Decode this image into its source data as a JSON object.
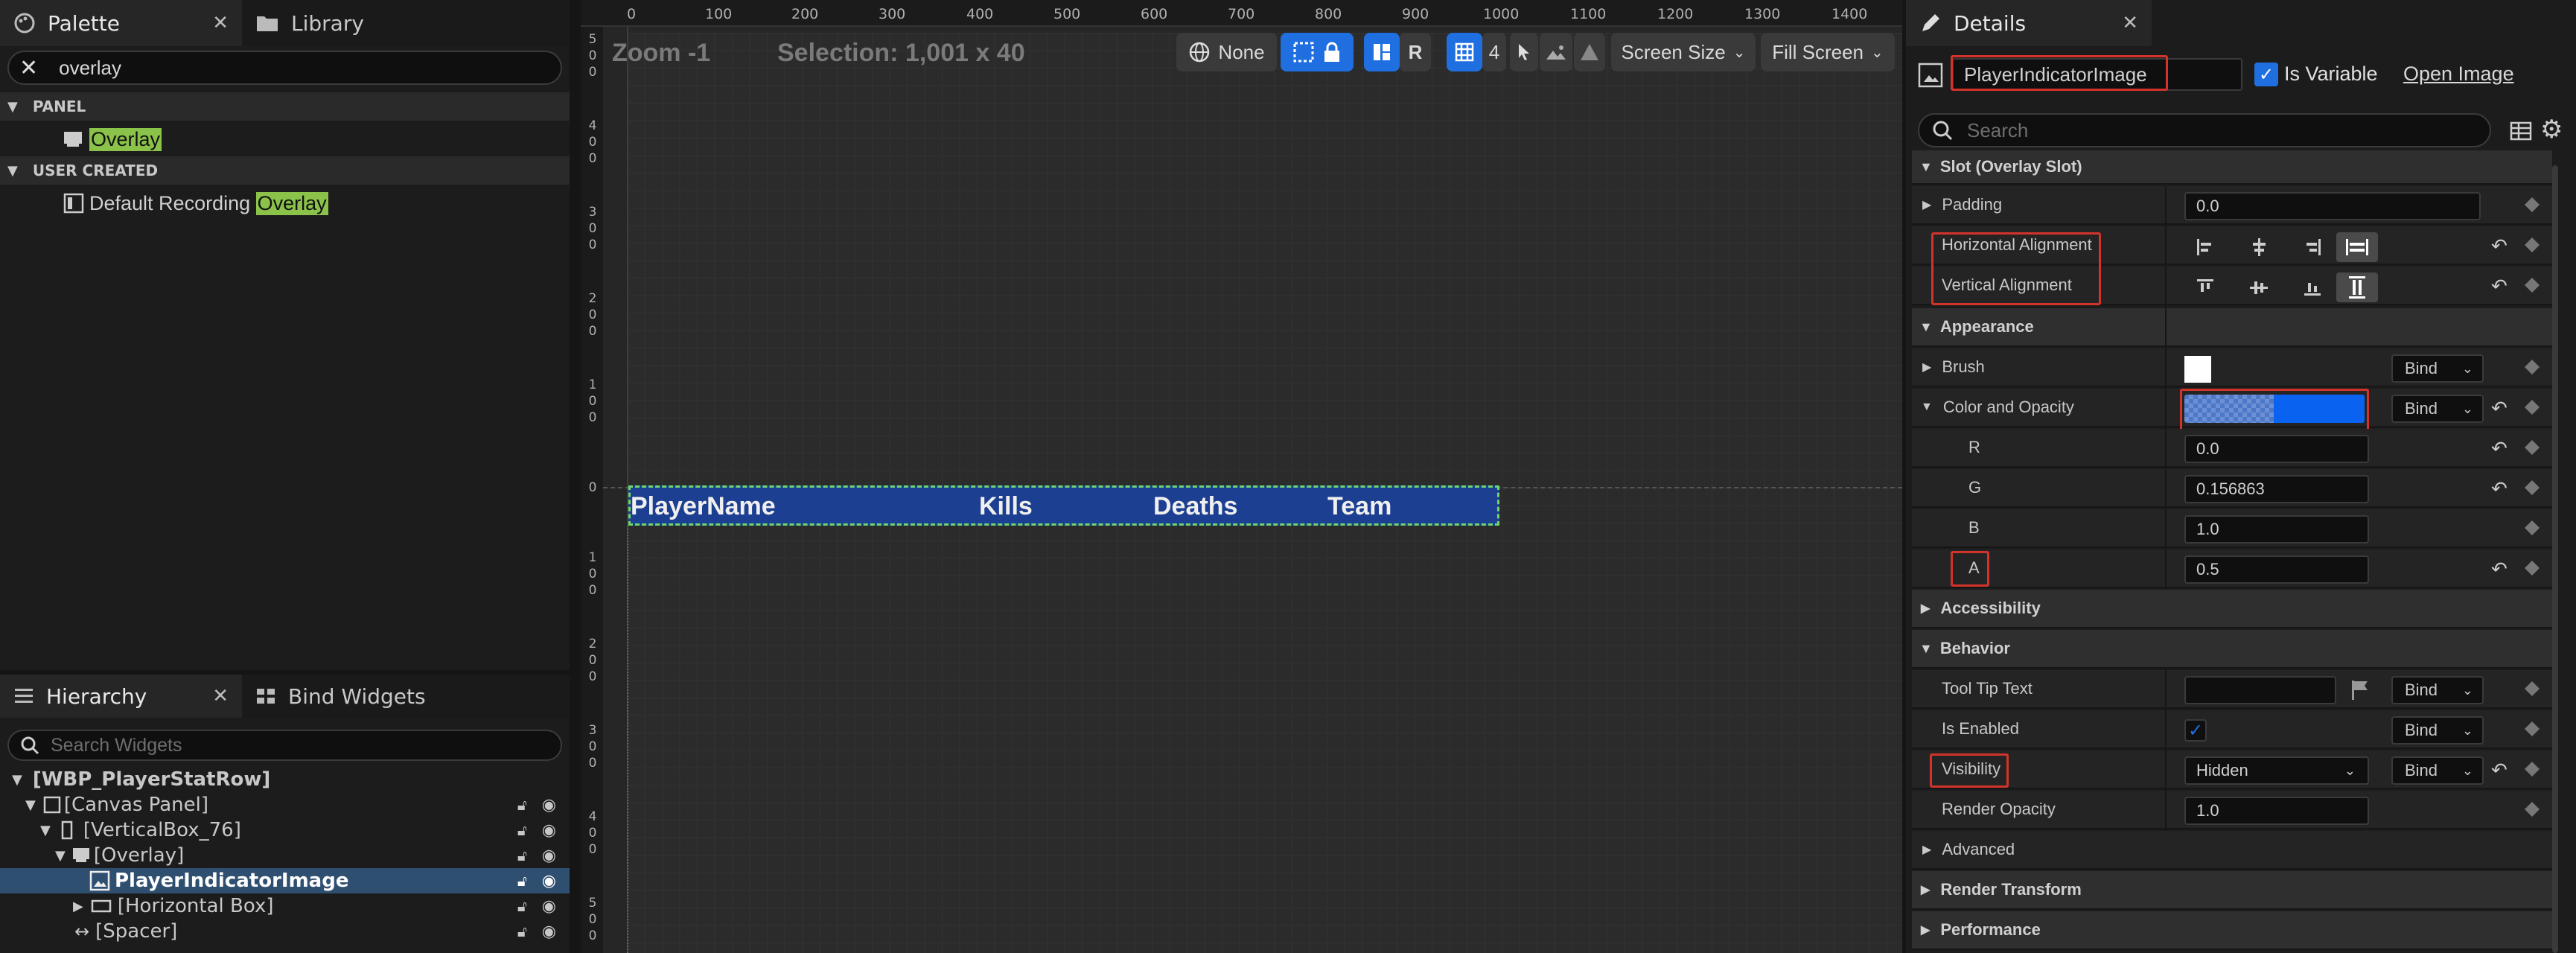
{
  "palette": {
    "tab_label": "Palette",
    "library_tab_label": "Library",
    "search_value": "overlay",
    "sections": [
      {
        "label": "PANEL",
        "items": [
          {
            "label": "Overlay"
          }
        ]
      },
      {
        "label": "USER CREATED",
        "items": [
          {
            "prefix": "Default Recording ",
            "label": "Overlay"
          }
        ]
      }
    ]
  },
  "hierarchy": {
    "tab_label": "Hierarchy",
    "bind_tab_label": "Bind Widgets",
    "search_placeholder": "Search Widgets",
    "items": [
      {
        "label": "[WBP_PlayerStatRow]"
      },
      {
        "label": "[Canvas Panel]"
      },
      {
        "label": "[VerticalBox_76]"
      },
      {
        "label": "[Overlay]"
      },
      {
        "label": "PlayerIndicatorImage"
      },
      {
        "label": "[Horizontal Box]"
      },
      {
        "label": "[Spacer]"
      }
    ]
  },
  "viewport": {
    "zoom_label": "Zoom -1",
    "selection_label": "Selection: 1,001 x 40",
    "none_label": "None",
    "r_label": "R",
    "grid_snap": "4",
    "screen_size_label": "Screen Size",
    "fill_screen_label": "Fill Screen",
    "ruler_top": [
      "0",
      "100",
      "200",
      "300",
      "400",
      "500",
      "600",
      "700",
      "800",
      "900",
      "1000",
      "1100",
      "1200",
      "1300",
      "1400"
    ],
    "ruler_left_top": [
      "5",
      "0",
      "0",
      "4",
      "0",
      "0",
      "3",
      "0",
      "0",
      "2",
      "0",
      "0",
      "1",
      "0",
      "0"
    ],
    "ruler_left_zero": "0",
    "ruler_left_bottom": [
      "1",
      "0",
      "0",
      "2",
      "0",
      "0",
      "3",
      "0",
      "0",
      "4",
      "0",
      "0",
      "5",
      "0",
      "0"
    ],
    "row_columns": [
      "PlayerName",
      "Kills",
      "Deaths",
      "Team"
    ]
  },
  "details": {
    "tab_label": "Details",
    "widget_name": "PlayerIndicatorImage",
    "is_variable_label": "Is Variable",
    "open_image_label": "Open Image",
    "search_placeholder": "Search",
    "bind_label": "Bind",
    "rows": {
      "slot": "Slot (Overlay Slot)",
      "padding": "Padding",
      "padding_value": "0.0",
      "halign": "Horizontal Alignment",
      "valign": "Vertical Alignment",
      "appearance": "Appearance",
      "brush": "Brush",
      "color_opacity": "Color and Opacity",
      "r": "R",
      "r_value": "0.0",
      "g": "G",
      "g_value": "0.156863",
      "b": "B",
      "b_value": "1.0",
      "a": "A",
      "a_value": "0.5",
      "accessibility": "Accessibility",
      "behavior": "Behavior",
      "tooltip": "Tool Tip Text",
      "is_enabled": "Is Enabled",
      "visibility": "Visibility",
      "visibility_value": "Hidden",
      "render_opacity": "Render Opacity",
      "render_opacity_value": "1.0",
      "advanced": "Advanced",
      "render_transform": "Render Transform",
      "performance": "Performance"
    }
  },
  "colors": {
    "accent_blue": "#1f6fe0",
    "selection_blue": "#2f4f70",
    "highlight_green": "#8bc34a",
    "annotation_red": "#d2332a",
    "row_fill": "#1d3f91"
  }
}
